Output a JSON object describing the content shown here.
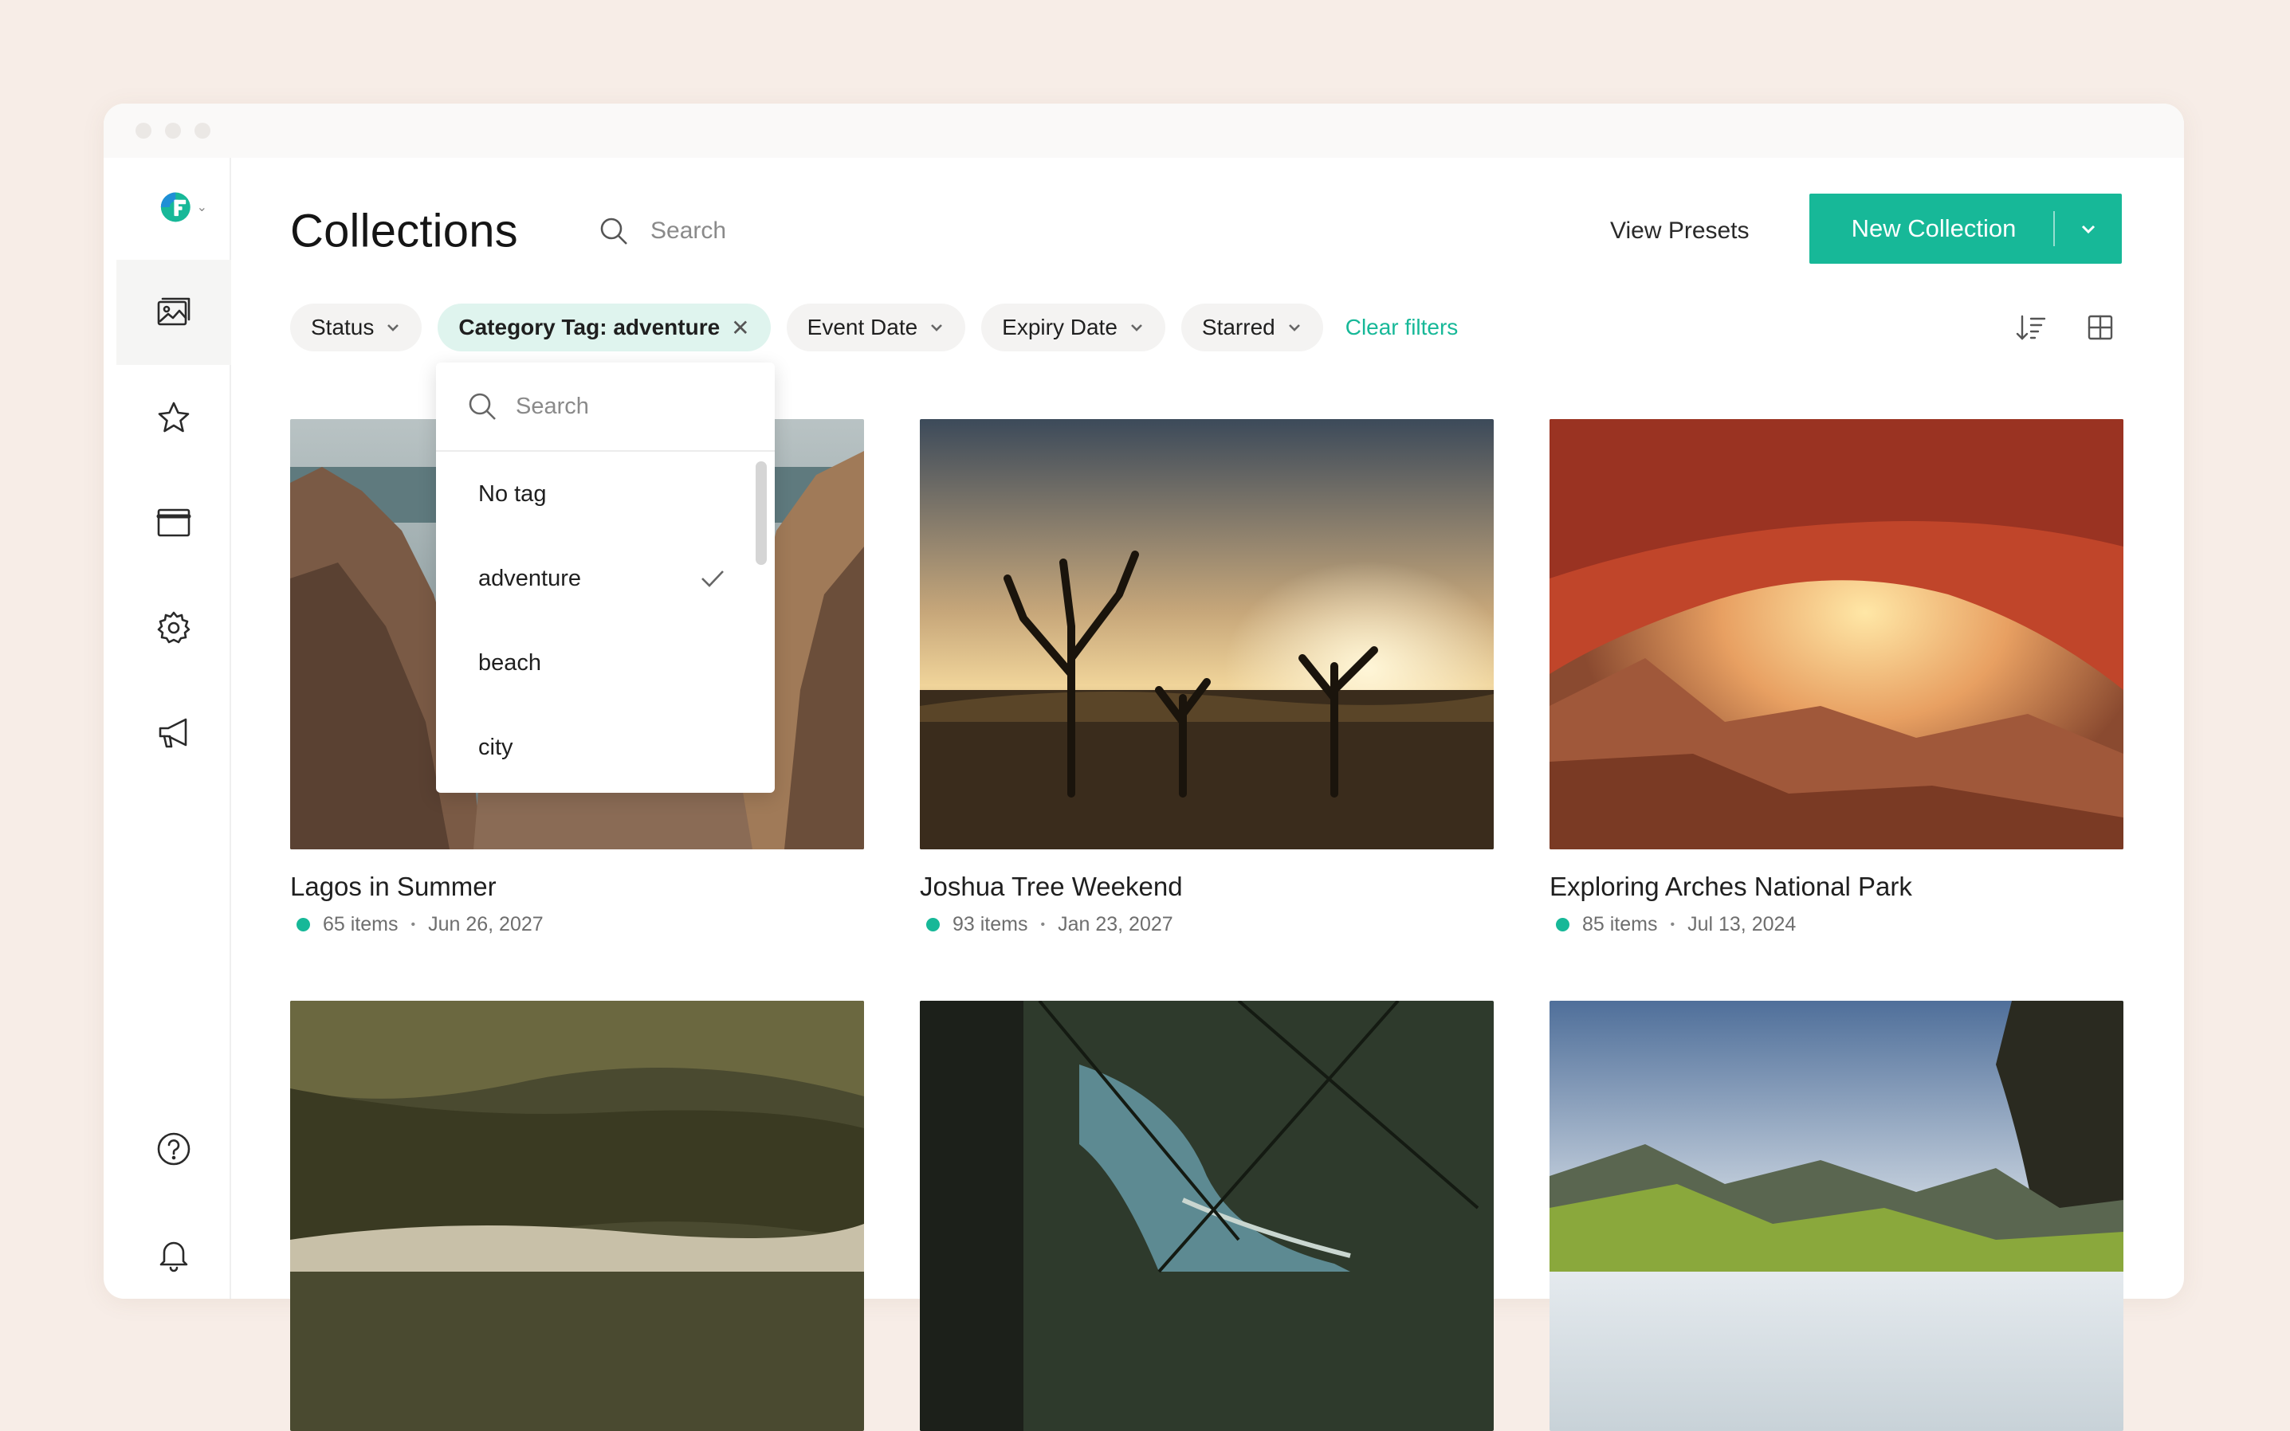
{
  "page": {
    "title": "Collections",
    "search_placeholder": "Search"
  },
  "header": {
    "view_presets_label": "View Presets",
    "new_collection_label": "New Collection"
  },
  "filters": {
    "status_label": "Status",
    "category_label": "Category Tag: adventure",
    "event_date_label": "Event Date",
    "expiry_date_label": "Expiry Date",
    "starred_label": "Starred",
    "clear_label": "Clear filters"
  },
  "dropdown": {
    "search_placeholder": "Search",
    "options": [
      {
        "label": "No tag",
        "selected": false
      },
      {
        "label": "adventure",
        "selected": true
      },
      {
        "label": "beach",
        "selected": false
      },
      {
        "label": "city",
        "selected": false
      }
    ]
  },
  "sidebar": {
    "items": [
      {
        "icon": "image-icon",
        "active": true
      },
      {
        "icon": "star-icon",
        "active": false
      },
      {
        "icon": "window-icon",
        "active": false
      },
      {
        "icon": "gear-icon",
        "active": false
      },
      {
        "icon": "megaphone-icon",
        "active": false
      },
      {
        "icon": "help-icon",
        "active": false
      },
      {
        "icon": "bell-icon",
        "active": false
      }
    ]
  },
  "collections": [
    {
      "title": "Lagos in Summer",
      "items": "65 items",
      "date": "Jun 26, 2027"
    },
    {
      "title": "Joshua Tree Weekend",
      "items": "93 items",
      "date": "Jan 23, 2027"
    },
    {
      "title": "Exploring Arches National Park",
      "items": "85 items",
      "date": "Jul 13, 2024"
    },
    {
      "title": "",
      "items": "",
      "date": ""
    },
    {
      "title": "",
      "items": "",
      "date": ""
    },
    {
      "title": "",
      "items": "",
      "date": ""
    }
  ],
  "colors": {
    "accent": "#17b898",
    "background": "#f7ede7",
    "chip_active": "#dff4ee"
  }
}
